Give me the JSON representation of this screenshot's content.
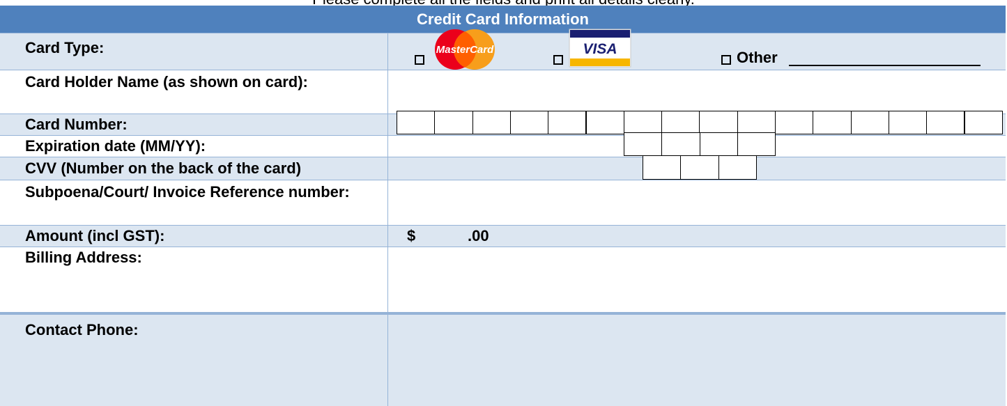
{
  "top_note": "Please complete all the fields and print all details clearly.",
  "title": "Credit Card Information",
  "rows": [
    {
      "label": "Card Type:"
    },
    {
      "label": "Card Holder Name (as shown on card):"
    },
    {
      "label": "Card Number:"
    },
    {
      "label": "Expiration date (MM/YY):"
    },
    {
      "label": "CVV (Number on the back of the card)"
    },
    {
      "label": "Subpoena/Court/ Invoice Reference number:"
    },
    {
      "label": "Amount (incl GST):"
    },
    {
      "label": "Billing Address:"
    },
    {
      "label": "Contact Phone:"
    }
  ],
  "card_type": {
    "mastercard_logo_text": "MasterCard",
    "visa_logo_text": "VISA",
    "other_label": "Other"
  },
  "card_number_boxes": 16,
  "expiration_boxes": 4,
  "cvv_boxes": 3,
  "amount": {
    "currency": "$",
    "cents": ".00"
  },
  "colors": {
    "header_bg": "#4f81bd",
    "shade_bg": "#dce6f1",
    "border": "#95b3d7",
    "mastercard_red": "#eb001b",
    "mastercard_orange": "#f79e1b",
    "visa_blue": "#1a1f71",
    "visa_gold": "#f7b600"
  }
}
